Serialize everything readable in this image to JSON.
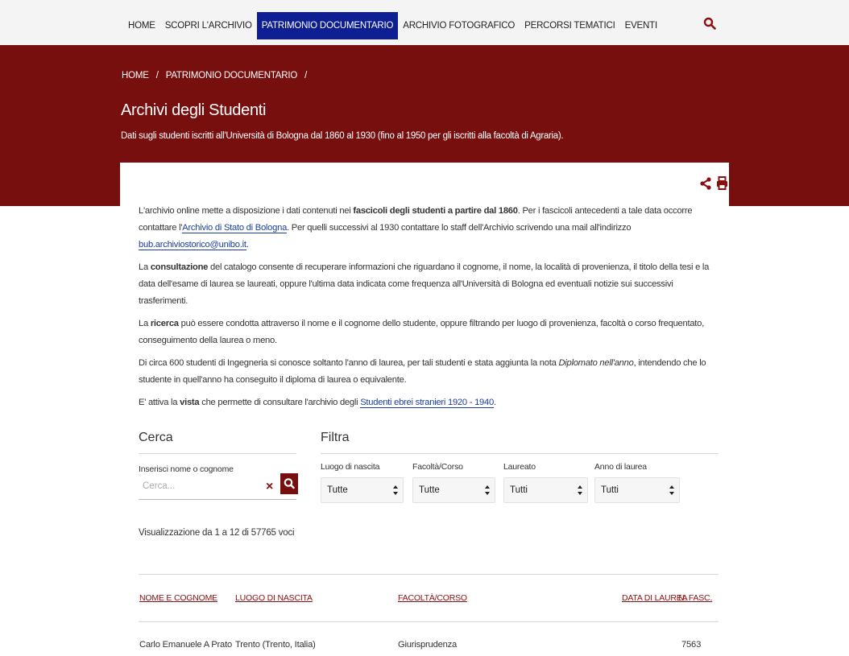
{
  "nav": {
    "items": [
      {
        "label": "HOME",
        "active": false
      },
      {
        "label": "SCOPRI L'ARCHIVIO",
        "active": false
      },
      {
        "label": "PATRIMONIO DOCUMENTARIO",
        "active": true
      },
      {
        "label": "ARCHIVIO FOTOGRAFICO",
        "active": false
      },
      {
        "label": "PERCORSI TEMATICI",
        "active": false
      },
      {
        "label": "EVENTI",
        "active": false
      }
    ],
    "search_icon": "search-icon"
  },
  "breadcrumb": {
    "home": "HOME",
    "sep1": "/",
    "current": "PATRIMONIO DOCUMENTARIO",
    "sep2": "/"
  },
  "header": {
    "title": "Archivi degli Studenti",
    "subtitle": "Dati sugli studenti iscritti all'Università di Bologna dal 1860 al 1930 (fino al 1950 per gli iscritti alla facoltà di Agraria)."
  },
  "tools": {
    "share_icon": "share-icon",
    "print_icon": "print-icon"
  },
  "intro": {
    "p1_a": "L'archivio online mette a disposizione i dati contenuti nei ",
    "p1_b": "fascicoli degli studenti a partire dal 1860",
    "p1_c": ". Per i fascicoli antecedenti a tale data occorre contattare l'",
    "p1_link1": "Archivio di Stato di Bologna",
    "p1_d": ". Per quelli successivi al 1930 contattare lo staff dell'Archivio scrivendo una mail all'indirizzo ",
    "p1_link2": "bub.archiviostorico@unibo.it",
    "p1_e": ".",
    "p2_a": "La ",
    "p2_b": "consultazione",
    "p2_c": " del catalogo consente di recuperare informazioni che riguardano il cognome, il nome, la località di provenienza, il titolo della tesi e la data dell'esame di laurea se laureati, oppure l'ultima data indicata come frequenza all'Università di Bologna ed eventuali notizie sui successivi trasferimenti.",
    "p3_a": "La ",
    "p3_b": "ricerca",
    "p3_c": " può essere condotta attraverso il nome e il cognome dello studente, oppure filtrando per luogo di provenienza, facoltà o corso frequentato, conseguimento della laurea o meno.",
    "p4_a": "Di circa 600 studenti di Ingegneria si conosce soltanto l'anno di laurea, per tali studenti e stata aggiunta la nota ",
    "p4_b": "Diplomato nell'anno",
    "p4_c": ", intendendo che lo studente in quell'anno ha conseguito il diploma di laurea o equivalente.",
    "p5_a": "E' attiva la ",
    "p5_b": "vista",
    "p5_c": " che permette di consultare l'archivio degli ",
    "p5_link": "Studenti ebrei stranieri 1920 - 1940",
    "p5_d": "."
  },
  "search": {
    "title": "Cerca",
    "label": "Inserisci nome o cognome",
    "placeholder": "Cerca...",
    "value": "",
    "clear": "×"
  },
  "filter": {
    "title": "Filtra",
    "fields": [
      {
        "label": "Luogo di nascita",
        "value": "Tutte"
      },
      {
        "label": "Facoltà/Corso",
        "value": "Tutte"
      },
      {
        "label": "Laureato",
        "value": "Tutti"
      },
      {
        "label": "Anno di laurea",
        "value": "Tutti"
      }
    ],
    "arrows": "▲\n▼"
  },
  "results": {
    "count_text": "Visualizzazione da 1 a 12 di 57765 voci"
  },
  "table": {
    "headers": [
      "NOME E COGNOME",
      "LUOGO DI NASCITA",
      "FACOLTÀ/CORSO",
      "DATA DI LAUREA",
      "N. FASC."
    ],
    "rows": [
      [
        "Carlo Emanuele A Prato",
        "Trento (Trento, Italia)",
        "Giurisprudenza",
        "",
        "7563"
      ]
    ]
  },
  "colors": {
    "brand_red": "#780f0f",
    "nav_active": "#0d1f93",
    "link": "#1a3ea0"
  }
}
